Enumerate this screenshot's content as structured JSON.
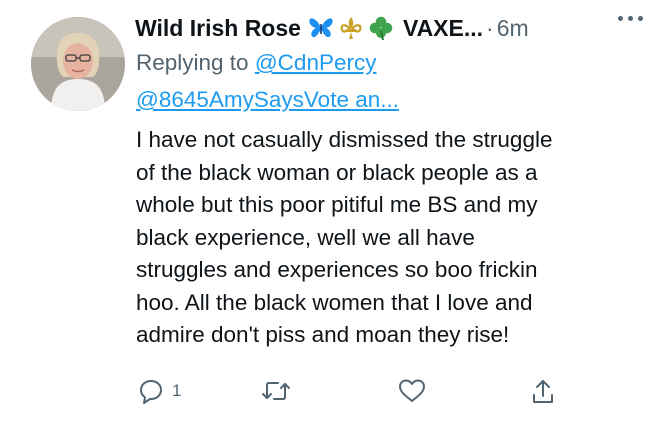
{
  "user": {
    "display_name": "Wild Irish Rose",
    "emojis": [
      "butterfly-icon",
      "fleur-de-lis-icon",
      "shamrock-icon"
    ],
    "display_name_suffix": "VAXE...",
    "separator": "·",
    "time": "6m"
  },
  "reply": {
    "prefix": "Replying to",
    "mention_1": "@CdnPercy",
    "mention_2": "@8645AmySaysVote an..."
  },
  "body": {
    "lines": [
      "I have not casually dismissed the struggle",
      "of the black woman or black people as a",
      "whole but this poor pitiful me BS and my",
      "black experience, well we all have",
      "struggles and experiences so boo frickin",
      "hoo. All the black women that I love and",
      "admire don't piss and moan they rise!"
    ]
  },
  "actions": {
    "reply_count": "1",
    "icons": [
      "reply-icon",
      "retweet-icon",
      "like-icon",
      "share-icon"
    ]
  },
  "colors": {
    "text": "#0f1419",
    "secondary": "#536471",
    "link": "#1d9bf0",
    "butterfly": "#1d8ff0",
    "fleur": "#c9a227",
    "shamrock": "#3fa34d"
  }
}
